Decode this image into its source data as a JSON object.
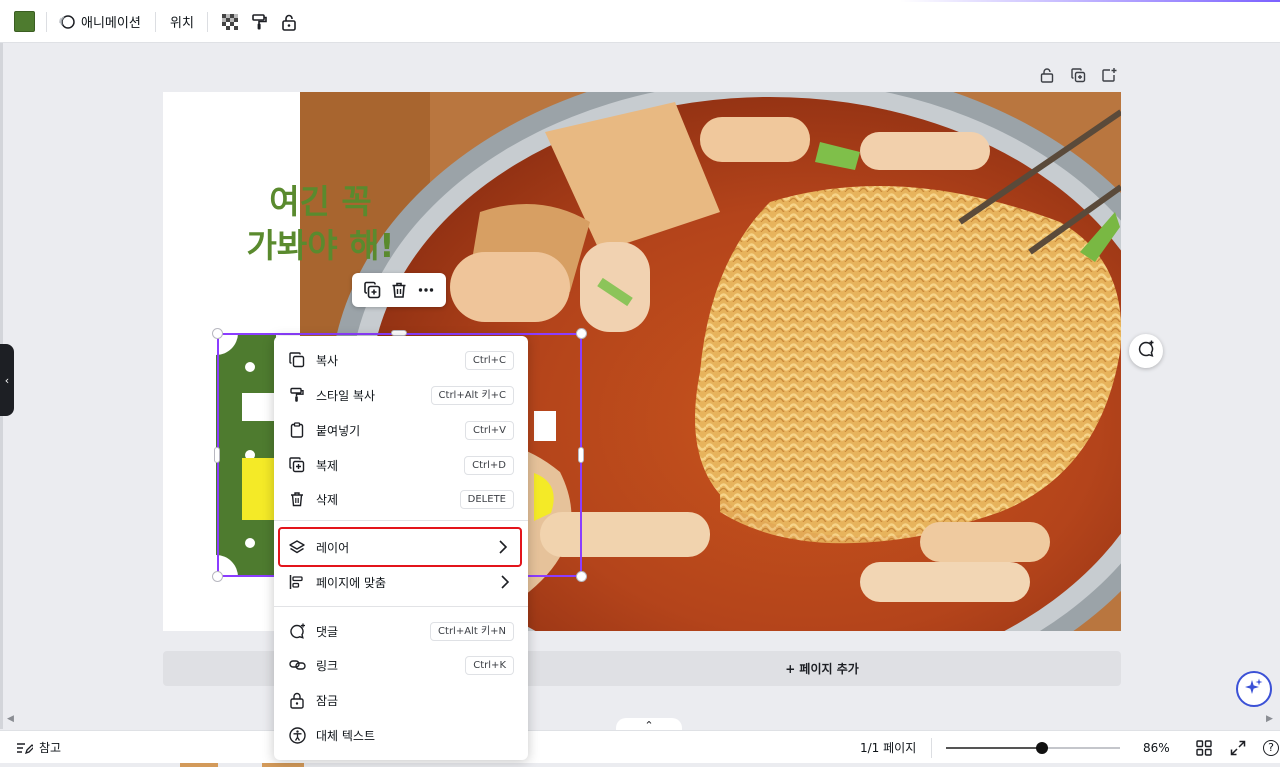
{
  "toolbar": {
    "swatch_color": "#4e7b2f",
    "animation_label": "애니메이션",
    "position_label": "위치",
    "icons": [
      "animation-icon",
      "transparency-icon",
      "paint-roller-icon",
      "lock-icon"
    ]
  },
  "page_tools": [
    "lock-icon",
    "duplicate-page-icon",
    "add-page-icon"
  ],
  "design": {
    "headline_line1": "여긴 꼭",
    "headline_line2": "가봐야 해!",
    "brand_green": "#5a8a2e"
  },
  "floating_toolbar": [
    "duplicate-icon",
    "trash-icon",
    "more-icon"
  ],
  "context_menu": {
    "items": [
      {
        "label": "복사",
        "shortcut": "Ctrl+C",
        "icon": "copy-icon"
      },
      {
        "label": "스타일 복사",
        "shortcut": "Ctrl+Alt 키+C",
        "icon": "paint-roller-icon"
      },
      {
        "label": "붙여넣기",
        "shortcut": "Ctrl+V",
        "icon": "clipboard-icon"
      },
      {
        "label": "복제",
        "shortcut": "Ctrl+D",
        "icon": "duplicate-icon"
      },
      {
        "label": "삭제",
        "shortcut": "DELETE",
        "icon": "trash-icon"
      },
      {
        "label": "레이어",
        "shortcut": "",
        "icon": "layers-icon",
        "submenu": true,
        "highlighted": true
      },
      {
        "label": "페이지에 맞춤",
        "shortcut": "",
        "icon": "align-icon",
        "submenu": true
      },
      {
        "label": "댓글",
        "shortcut": "Ctrl+Alt 키+N",
        "icon": "comment-add-icon"
      },
      {
        "label": "링크",
        "shortcut": "Ctrl+K",
        "icon": "link-icon"
      },
      {
        "label": "잠금",
        "shortcut": "",
        "icon": "lock-icon"
      },
      {
        "label": "대체 텍스트",
        "shortcut": "",
        "icon": "accessibility-icon"
      }
    ]
  },
  "add_page_label": "+ 페이지 추가",
  "bottombar": {
    "notes_label": "참고",
    "page_indicator": "1/1 페이지",
    "zoom_label": "86%",
    "zoom_fraction": 0.55,
    "help_label": "?"
  }
}
